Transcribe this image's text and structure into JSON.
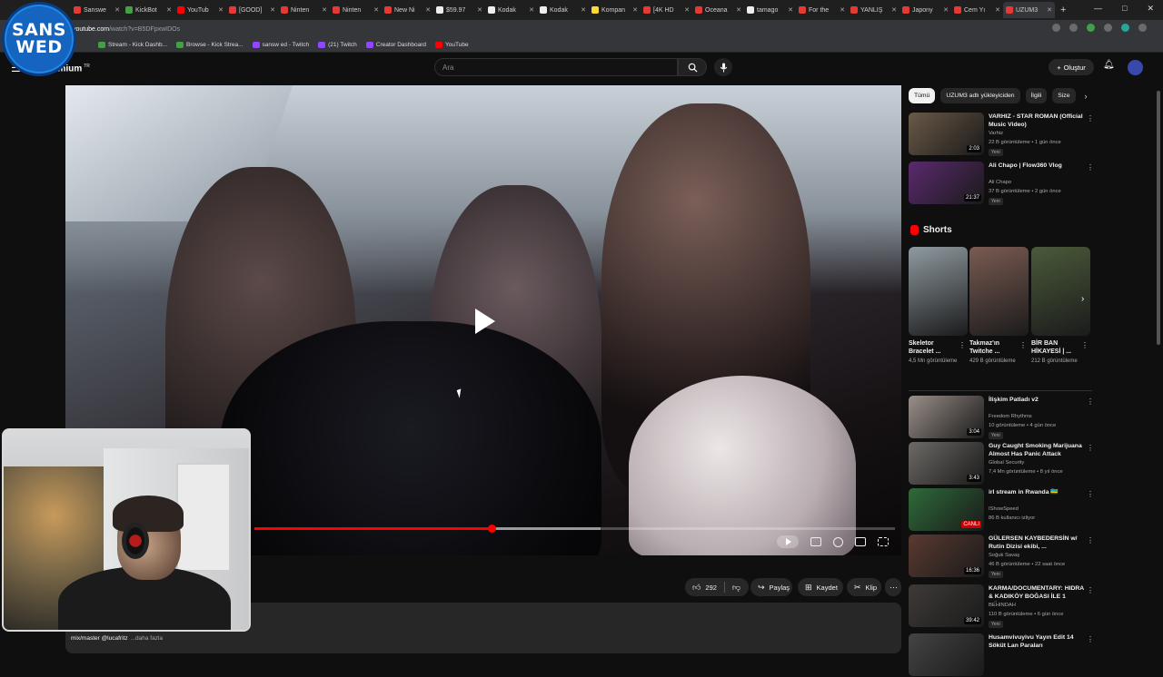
{
  "browser": {
    "tabs": [
      {
        "label": "Sanswe",
        "color": "#e53935"
      },
      {
        "label": "KickBot",
        "color": "#43a047"
      },
      {
        "label": "YouTub",
        "color": "#ff0000"
      },
      {
        "label": "[GOOD]",
        "color": "#e53935"
      },
      {
        "label": "Ninten",
        "color": "#e53935"
      },
      {
        "label": "Ninten",
        "color": "#e53935"
      },
      {
        "label": "New Ni",
        "color": "#e53935"
      },
      {
        "label": "$59.97",
        "color": "#eeeeee"
      },
      {
        "label": "Kodak",
        "color": "#eeeeee"
      },
      {
        "label": "Kodak",
        "color": "#eeeeee"
      },
      {
        "label": "Kompan",
        "color": "#fdd835"
      },
      {
        "label": "[4K HD",
        "color": "#e53935"
      },
      {
        "label": "Oceana",
        "color": "#e53935"
      },
      {
        "label": "tamago",
        "color": "#eeeeee"
      },
      {
        "label": "For the",
        "color": "#e53935"
      },
      {
        "label": "YANLIŞ",
        "color": "#e53935"
      },
      {
        "label": "Japony",
        "color": "#e53935"
      },
      {
        "label": "Cem Yı",
        "color": "#e53935"
      },
      {
        "label": "UZUM3",
        "color": "#e53935",
        "active": true
      }
    ],
    "url_host": "youtube.com",
    "url_path": "/watch?v=B5DFpxwIDOs",
    "bookmarks": [
      {
        "label": "Stream - Kick Dashb...",
        "color": "#43a047"
      },
      {
        "label": "Browse - Kick Strea...",
        "color": "#43a047"
      },
      {
        "label": "sansw ed - Twitch",
        "color": "#9146ff"
      },
      {
        "label": "(21) Twitch",
        "color": "#9146ff"
      },
      {
        "label": "Creator Dashboard",
        "color": "#9146ff"
      },
      {
        "label": "YouTube",
        "color": "#ff0000"
      }
    ]
  },
  "overlay": {
    "logo_line1": "SANS",
    "logo_line2": "WED"
  },
  "yt_header": {
    "brand": "emium",
    "brand_sup": "TR",
    "search_placeholder": "Ara",
    "create_label": "Oluştur"
  },
  "player": {
    "progress_played": 0.37,
    "progress_buffered": 0.54
  },
  "actions": {
    "like_count": "292",
    "share_label": "Paylaş",
    "save_label": "Kaydet",
    "clip_label": "Klip"
  },
  "description": {
    "text": "mix/master @lucafritz",
    "more": "...daha fazla"
  },
  "sidebar": {
    "chips": [
      "Tümü",
      "UZUM3 adlı yükleyiciden",
      "İlgili",
      "Size"
    ],
    "videos_top": [
      {
        "title": "VARHIZ - STAR ROMAN (Official Music Video)",
        "channel": "Varhiz",
        "meta": "22 B görüntüleme • 1 gün önce",
        "badge": "Yeni",
        "duration": "2:03",
        "thumb": "#6a5a48"
      },
      {
        "title": "Ali Chapo | Flow360 Vlog",
        "channel": "Ali Chapo",
        "meta": "37 B görüntüleme • 2 gün önce",
        "badge": "Yeni",
        "duration": "21:37",
        "thumb": "#5a2a6e"
      }
    ],
    "shorts_title": "Shorts",
    "shorts": [
      {
        "title": "Skeletor Bracelet ...",
        "views": "4,5 Mn görüntüleme",
        "thumb": "#8f9aa0"
      },
      {
        "title": "Takmaz'ın Twitche ...",
        "views": "429 B görüntüleme",
        "thumb": "#7a5b52"
      },
      {
        "title": "BİR BAN HİKAYESİ | ...",
        "views": "212 B görüntüleme",
        "thumb": "#4a5a3a"
      }
    ],
    "videos_bottom": [
      {
        "title": "İlişkim Patladı v2",
        "channel": "Freedom Rhythms",
        "meta": "10 görüntüleme • 4 gün önce",
        "badge": "Yeni",
        "duration": "3:04",
        "thumb": "#9a8f8a"
      },
      {
        "title": "Guy Caught Smoking Marijuana Almost Has Panic Attack",
        "channel": "Global Security",
        "meta": "7,4 Mn görüntüleme • 8 yıl önce",
        "badge": "",
        "duration": "3:43",
        "thumb": "#6d6a66"
      },
      {
        "title": "irl stream in Rwanda 🇷🇼",
        "channel": "IShowSpeed",
        "meta": "86 B kullanıcı izliyor",
        "badge": "",
        "duration": "CANLI",
        "live": true,
        "thumb": "#2e6b3a"
      },
      {
        "title": "GÜLERSEN KAYBEDERSİN w/ Rutin Dizisi ekibi, ...",
        "channel": "Soğuk Savaş",
        "meta": "46 B görüntüleme • 22 saat önce",
        "badge": "Yeni",
        "duration": "16:36",
        "thumb": "#5a3a30"
      },
      {
        "title": "KARMA/DOCUMENTARY: HIDRA & KADIKÖY BOĞASI İLE 1 GÜN...",
        "channel": "BEHINDAH",
        "meta": "110 B görüntüleme • 6 gün önce",
        "badge": "Yeni",
        "duration": "39:42",
        "thumb": "#3e3a38"
      },
      {
        "title": "Husamvivuyivu Yayın Edit 14 Söküt Lan Paraları",
        "channel": "",
        "meta": "",
        "badge": "",
        "duration": "",
        "thumb": "#444"
      }
    ]
  }
}
